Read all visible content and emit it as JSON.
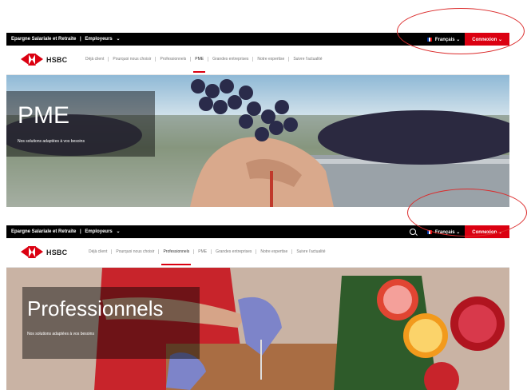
{
  "screenshots": [
    {
      "topbar": {
        "links": [
          "Epargne Salariale et Retraite",
          "|",
          "Employeurs",
          "⌄"
        ],
        "language": "Français ⌄",
        "connect": "Connexion ⌄"
      },
      "brand": "HSBC",
      "nav": [
        "Déjà client",
        "Pourquoi nous choisir",
        "Professionnels",
        "PME",
        "Grandes entreprises",
        "Notre expertise",
        "Suivre l'actualité"
      ],
      "active_nav": "PME",
      "hero": {
        "title": "PME",
        "subtitle": "Nos solutions adaptées à vos besoins"
      }
    },
    {
      "topbar": {
        "links": [
          "Epargne Salariale et Retraite",
          "|",
          "Employeurs",
          "⌄"
        ],
        "language": "Français ⌄",
        "connect": "Connexion ⌄"
      },
      "brand": "HSBC",
      "nav": [
        "Déjà client",
        "Pourquoi nous choisir",
        "Professionnels",
        "PME",
        "Grandes entreprises",
        "Notre expertise",
        "Suivre l'actualité"
      ],
      "active_nav": "Professionnels",
      "hero": {
        "title": "Professionnels",
        "subtitle": "Nos solutions adaptées à vos besoins"
      }
    }
  ],
  "colors": {
    "accent_red": "#db0011",
    "highlight_circle": "#db2b2b",
    "topbar": "#000000"
  }
}
